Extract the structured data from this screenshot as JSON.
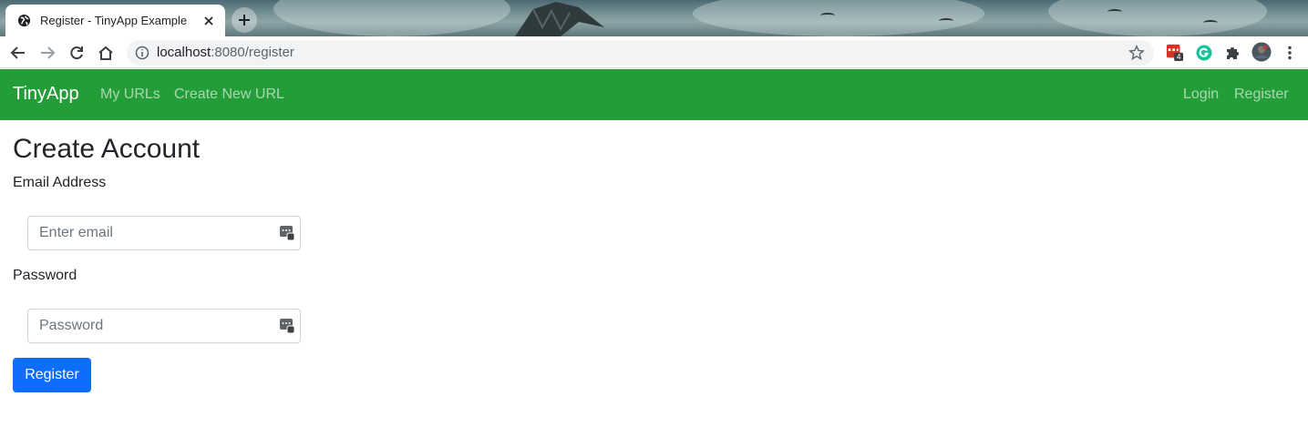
{
  "browser": {
    "tab_title": "Register - TinyApp Example",
    "url_host": "localhost",
    "url_port_path": ":8080/register",
    "extension_badge": "4"
  },
  "navbar": {
    "brand": "TinyApp",
    "links": [
      "My URLs",
      "Create New URL"
    ],
    "right_links": [
      "Login",
      "Register"
    ],
    "color": "#239d38"
  },
  "form": {
    "title": "Create Account",
    "email_label": "Email Address",
    "email_placeholder": "Enter email",
    "password_label": "Password",
    "password_placeholder": "Password",
    "submit_label": "Register",
    "submit_color": "#0d6efd"
  }
}
